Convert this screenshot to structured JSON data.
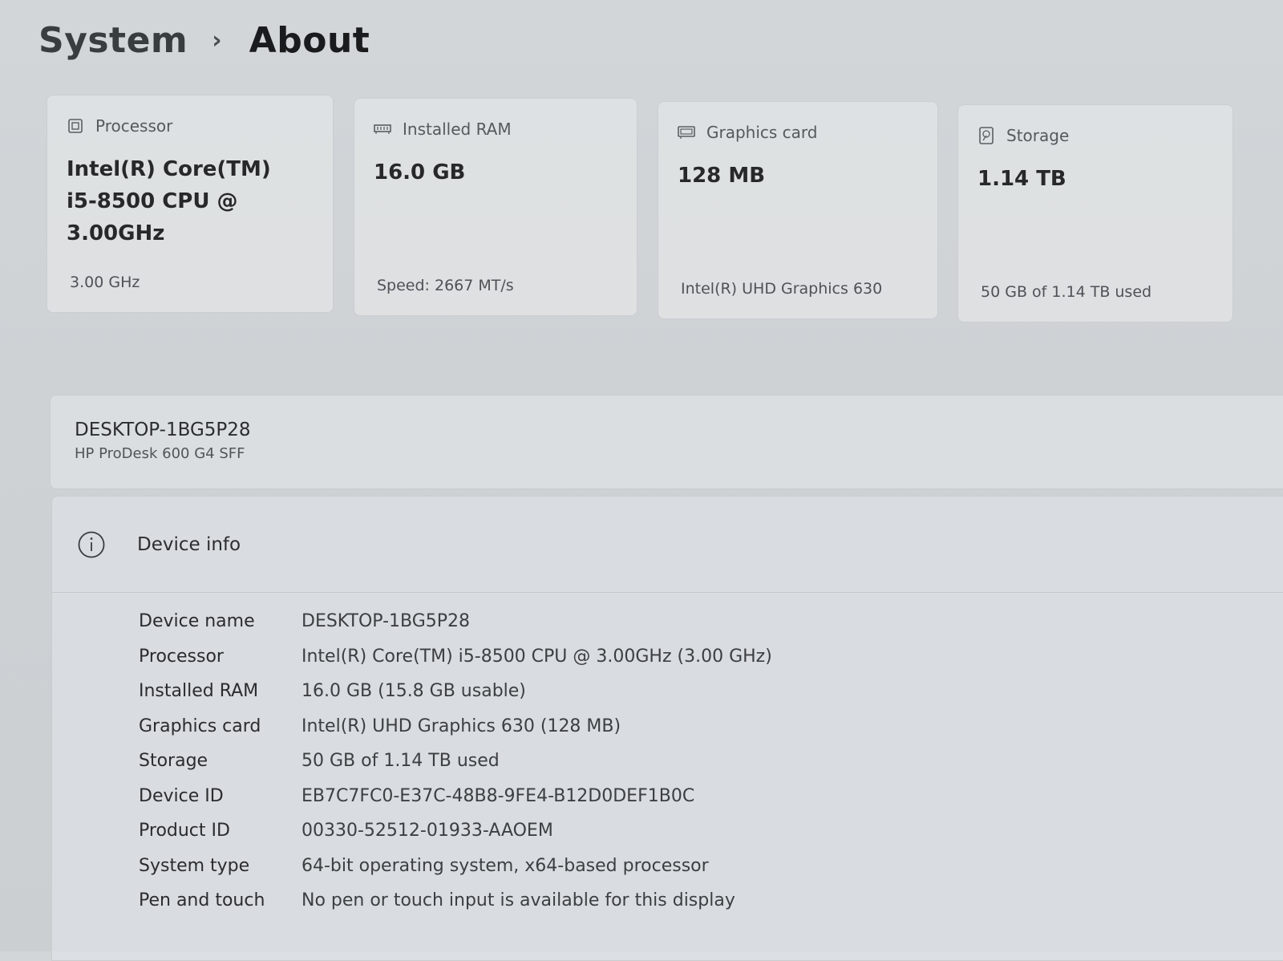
{
  "breadcrumb": {
    "parent": "System",
    "separator": "›",
    "current": "About"
  },
  "cards": [
    {
      "icon": "processor-icon",
      "title": "Processor",
      "value_lines": [
        "Intel(R) Core(TM)",
        "i5-8500 CPU @",
        "3.00GHz"
      ],
      "sub": "3.00 GHz"
    },
    {
      "icon": "ram-icon",
      "title": "Installed RAM",
      "value_lines": [
        "16.0 GB"
      ],
      "sub": "Speed: 2667 MT/s"
    },
    {
      "icon": "graphics-card-icon",
      "title": "Graphics card",
      "value_lines": [
        "128 MB"
      ],
      "sub": "Intel(R) UHD Graphics 630"
    },
    {
      "icon": "storage-icon",
      "title": "Storage",
      "value_lines": [
        "1.14 TB"
      ],
      "sub": "50 GB of 1.14 TB used"
    }
  ],
  "device": {
    "name": "DESKTOP-1BG5P28",
    "model": "HP ProDesk 600 G4 SFF"
  },
  "device_info": {
    "icon": "info-icon",
    "title": "Device info",
    "rows": [
      {
        "label": "Device name",
        "value": "DESKTOP-1BG5P28"
      },
      {
        "label": "Processor",
        "value": "Intel(R) Core(TM) i5-8500 CPU @ 3.00GHz (3.00 GHz)"
      },
      {
        "label": "Installed RAM",
        "value": "16.0 GB (15.8 GB usable)"
      },
      {
        "label": "Graphics card",
        "value": "Intel(R) UHD Graphics 630 (128 MB)"
      },
      {
        "label": "Storage",
        "value": "50 GB of 1.14 TB used"
      },
      {
        "label": "Device ID",
        "value": "EB7C7FC0-E37C-48B8-9FE4-B12D0DEF1B0C"
      },
      {
        "label": "Product ID",
        "value": "00330-52512-01933-AAOEM"
      },
      {
        "label": "System type",
        "value": "64-bit operating system, x64-based processor"
      },
      {
        "label": "Pen and touch",
        "value": "No pen or touch input is available for this display"
      }
    ]
  },
  "colors": {
    "background": "#cfd3d6",
    "card": "#e1e4e6",
    "text_primary": "#1f1f1f",
    "text_secondary": "#55595c"
  }
}
